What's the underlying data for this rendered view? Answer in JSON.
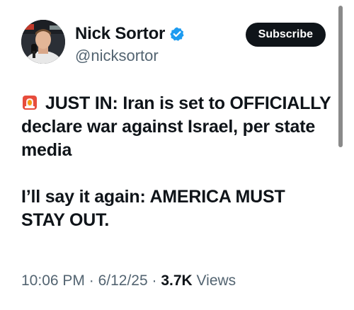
{
  "author": {
    "display_name": "Nick Sortor",
    "handle": "@nicksortor",
    "verified": true,
    "avatar_icon": "profile-photo",
    "verified_icon": "verified-badge-icon",
    "verified_color": "#1d9bf0"
  },
  "actions": {
    "subscribe_label": "Subscribe"
  },
  "tweet": {
    "siren_icon": "rotating-light-emoji",
    "paragraph_1": "JUST IN: Iran is set to OFFICIALLY declare war against Israel, per state media",
    "paragraph_2": "I’ll say it again: AMERICA MUST STAY OUT."
  },
  "meta": {
    "time": "10:06 PM",
    "date": "6/12/25",
    "views_count": "3.7K",
    "views_label": "Views",
    "separator": "·"
  },
  "colors": {
    "text_primary": "#0f1419",
    "text_secondary": "#536471",
    "button_bg": "#0f1419",
    "button_text": "#ffffff"
  }
}
